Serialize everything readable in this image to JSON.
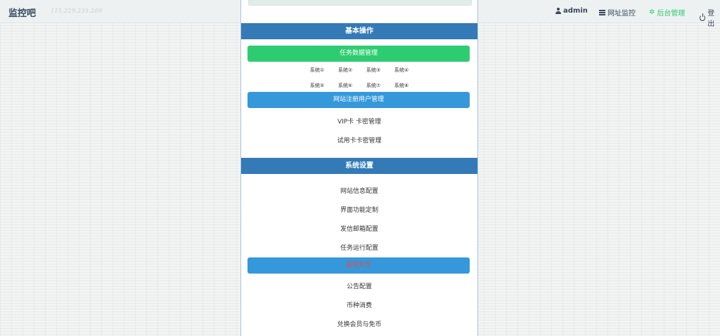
{
  "header": {
    "brand": "监控吧",
    "ip": "115.229.235.209",
    "nav": {
      "admin": "admin",
      "monitor": "网址监控",
      "backend": "后台管理",
      "logout": "登出"
    }
  },
  "basic": {
    "title": "基本操作",
    "task_data_btn": "任务数据管理",
    "systems": [
      "系统①",
      "系统②",
      "系统③",
      "系统④",
      "系统⑤",
      "系统⑥",
      "系统⑦",
      "系统⑧"
    ],
    "user_mgmt_btn": "网站注册用户管理",
    "vip_card": "VIP卡 卡密管理",
    "trial_card": "试用卡卡密管理"
  },
  "settings": {
    "title": "系统设置",
    "site_info": "网站信息配置",
    "ui_custom": "界面功能定制",
    "mail_config": "发信邮箱配置",
    "task_run": "任务运行配置",
    "monitor_file_btn": "监控文件",
    "notice": "公告配置",
    "currency": "币种消费",
    "exchange": "兑换会员与免币"
  },
  "colors": {
    "primary": "#337ab7",
    "success": "#2ecc71",
    "info": "#3498db",
    "danger": "#e74c3c"
  }
}
